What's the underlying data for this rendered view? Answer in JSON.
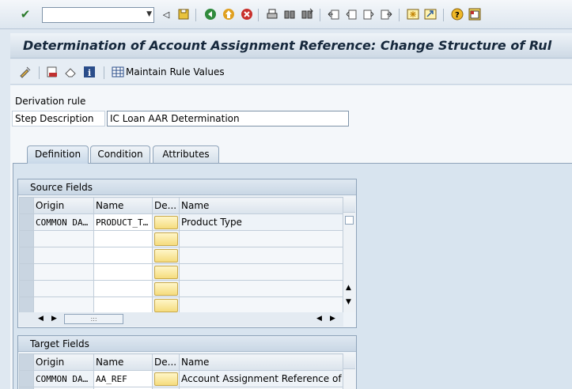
{
  "toolbar": {
    "command_field_value": "",
    "icons": [
      "check-icon",
      "back-arrow-icon",
      "save-icon",
      "back-icon",
      "exit-icon",
      "cancel-icon",
      "print-icon",
      "find-icon",
      "find-next-icon",
      "first-page-icon",
      "prev-page-icon",
      "next-page-icon",
      "last-page-icon",
      "new-session-icon",
      "shortcut-icon",
      "help-icon",
      "customize-layout-icon"
    ]
  },
  "title": "Determination of Account Assignment Reference: Change Structure of Rul",
  "app_toolbar": {
    "maintain_rule_values_label": "Maintain Rule Values"
  },
  "form": {
    "derivation_rule_label": "Derivation rule",
    "step_description_label": "Step Description",
    "step_description_value": "IC Loan AAR Determination"
  },
  "tabs": [
    {
      "label": "Definition",
      "active": true
    },
    {
      "label": "Condition",
      "active": false
    },
    {
      "label": "Attributes",
      "active": false
    }
  ],
  "source_fields": {
    "title": "Source Fields",
    "columns": [
      "Origin",
      "Name",
      "De...",
      "Name"
    ],
    "rows": [
      {
        "origin": "COMMON DA…",
        "name": "PRODUCT_T…",
        "desc_name": "Product Type"
      }
    ]
  },
  "target_fields": {
    "title": "Target Fields",
    "columns": [
      "Origin",
      "Name",
      "De...",
      "Name"
    ],
    "rows": [
      {
        "origin": "COMMON DA…",
        "name": "AA_REF",
        "desc_name": "Account Assignment Reference of Po"
      }
    ]
  },
  "colors": {
    "title_text": "#16283c",
    "detail_button": "#f5dc7e",
    "panel": "#d8e4ef"
  }
}
